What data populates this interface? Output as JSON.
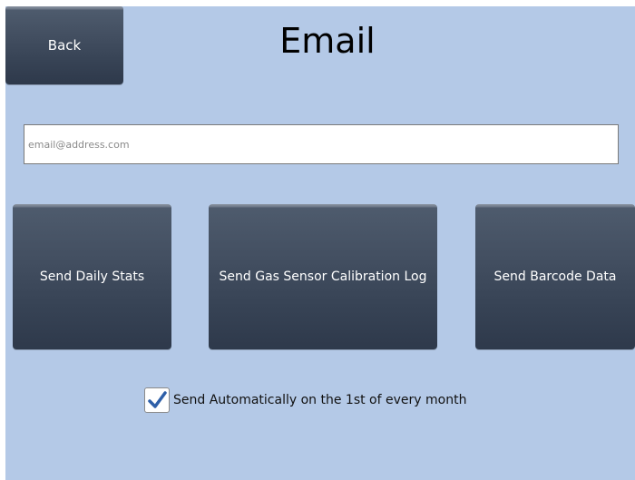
{
  "header": {
    "back_label": "Back",
    "title": "Email"
  },
  "email": {
    "value": "",
    "placeholder": "email@address.com"
  },
  "actions": {
    "send_daily_stats": "Send Daily Stats",
    "send_gas_sensor_log": "Send Gas Sensor Calibration Log",
    "send_barcode_data": "Send Barcode Data"
  },
  "auto_send": {
    "checked": true,
    "label": "Send Automatically on the 1st of every month"
  },
  "colors": {
    "background": "#b4c9e7",
    "button_top": "#4e5b6d",
    "button_bottom": "#2e394b",
    "checkmark": "#2e5fa8"
  }
}
